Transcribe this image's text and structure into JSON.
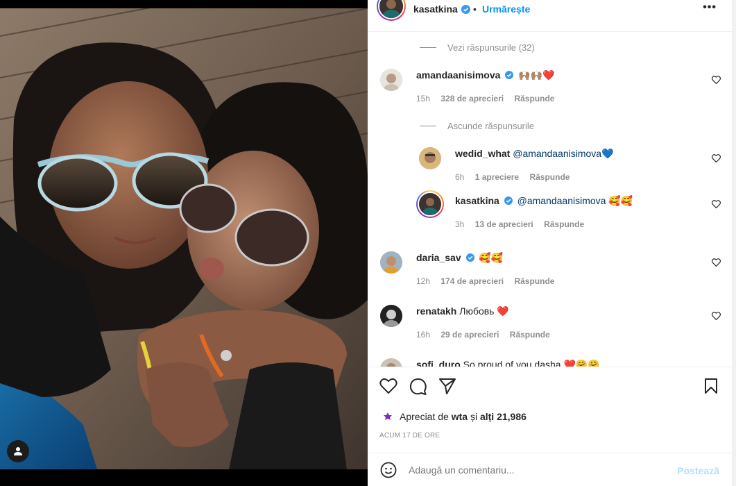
{
  "post": {
    "author": "kasatkina",
    "follow_label": "Urmărește",
    "dot": "•",
    "more": "•••"
  },
  "comments": {
    "view_replies_1": "Vezi răspunsurile (32)",
    "hide_replies": "Ascunde răspunsurile",
    "items": [
      {
        "user": "amandaanisimova",
        "verified": true,
        "text": "🙌🏽🙌🏽❤️",
        "mention": "",
        "time": "15h",
        "likes": "328 de aprecieri",
        "reply": "Răspunde"
      },
      {
        "user": "wedid_what",
        "verified": false,
        "text": "💙",
        "mention": "@amandaanisimova",
        "time": "6h",
        "likes": "1 apreciere",
        "reply": "Răspunde"
      },
      {
        "user": "kasatkina",
        "verified": true,
        "text": "🥰🥰",
        "mention": "@amandaanisimova",
        "time": "3h",
        "likes": "13 de aprecieri",
        "reply": "Răspunde"
      },
      {
        "user": "daria_sav",
        "verified": true,
        "text": "🥰🥰",
        "mention": "",
        "time": "12h",
        "likes": "174 de aprecieri",
        "reply": "Răspunde"
      },
      {
        "user": "renatakh",
        "verified": false,
        "text": "Любовь ❤️",
        "mention": "",
        "time": "16h",
        "likes": "29 de aprecieri",
        "reply": "Răspunde"
      },
      {
        "user": "sofi_duro",
        "verified": false,
        "text": "So proud of you dasha ❤️🤗🤗",
        "mention": "",
        "time": "",
        "likes": "",
        "reply": ""
      }
    ]
  },
  "engagement": {
    "liked_prefix": "Apreciat de",
    "liked_by": "wta",
    "liked_and": "și",
    "liked_others": "alți 21,986",
    "time_ago": "ACUM 17 DE ORE"
  },
  "composer": {
    "placeholder": "Adaugă un comentariu...",
    "post_label": "Postează"
  },
  "icons": {
    "like": "heart-icon",
    "comment": "comment-icon",
    "share": "share-icon",
    "save": "bookmark-icon",
    "emoji": "emoji-icon",
    "verified": "verified-badge-icon",
    "tag": "user-tag-icon"
  },
  "colors": {
    "link": "#0095f6",
    "muted": "#8e8e8e",
    "text": "#262626",
    "post_disabled": "#b2dffc"
  }
}
